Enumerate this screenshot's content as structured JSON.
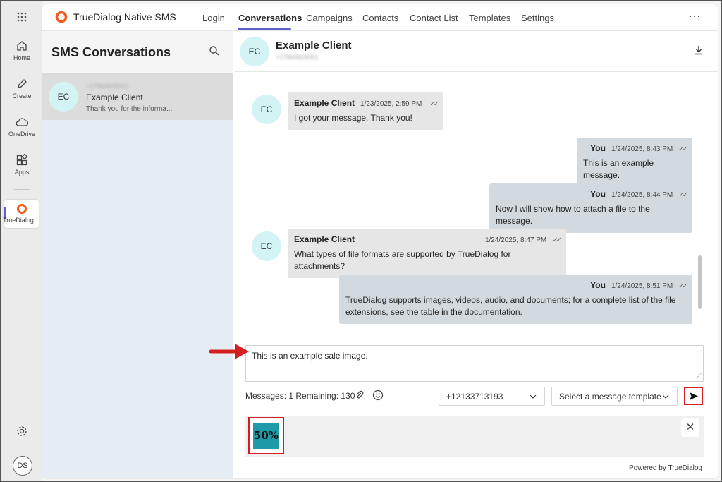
{
  "rail": {
    "items": [
      {
        "label": "Home",
        "icon": "home-icon"
      },
      {
        "label": "Create",
        "icon": "pencil-icon"
      },
      {
        "label": "OneDrive",
        "icon": "cloud-icon"
      },
      {
        "label": "Apps",
        "icon": "apps-icon"
      },
      {
        "label": "TrueDialog ...",
        "icon": "truedialog-icon"
      }
    ],
    "user_initials": "DS"
  },
  "app": {
    "title": "TrueDialog Native SMS",
    "brand_color": "#f25c1f",
    "accent_color": "#5b5fc7",
    "tabs": [
      {
        "label": "Login"
      },
      {
        "label": "Conversations",
        "active": true
      },
      {
        "label": "Campaigns"
      },
      {
        "label": "Contacts"
      },
      {
        "label": "Contact List"
      },
      {
        "label": "Templates"
      },
      {
        "label": "Settings"
      }
    ],
    "more": "···"
  },
  "conversations": {
    "title": "SMS Conversations",
    "items": [
      {
        "initials": "EC",
        "phone": "+17864829051",
        "name": "Example Client",
        "preview": "Thank you for the informa..."
      }
    ]
  },
  "chat": {
    "initials": "EC",
    "name": "Example Client",
    "phone": "+17864829051",
    "messages": [
      {
        "direction": "in",
        "sender": "Example Client",
        "time": "1/23/2025, 2:59 PM",
        "text": "I got your message. Thank you!"
      },
      {
        "direction": "out",
        "sender": "You",
        "time": "1/24/2025, 8:43 PM",
        "text": "This is an example message."
      },
      {
        "direction": "out",
        "sender": "You",
        "time": "1/24/2025, 8:44 PM",
        "text": "Now I will show how to attach a file to the message."
      },
      {
        "direction": "in",
        "sender": "Example Client",
        "time": "1/24/2025, 8:47 PM",
        "text": "What types of file formats are supported by TrueDialog for attachments?"
      },
      {
        "direction": "out",
        "sender": "You",
        "time": "1/24/2025, 8:51 PM",
        "text": "TrueDialog supports images, videos, audio, and documents; for a complete list of the file extensions, see the table in the documentation."
      }
    ],
    "composer_value": "This is an example sale image.",
    "counter": "Messages: 1 Remaining: 130",
    "from_number": "+12133713193",
    "template_placeholder": "Select a message template",
    "attachment_text": "50%",
    "close": "✕",
    "powered_by": "Powered by TrueDialog"
  }
}
